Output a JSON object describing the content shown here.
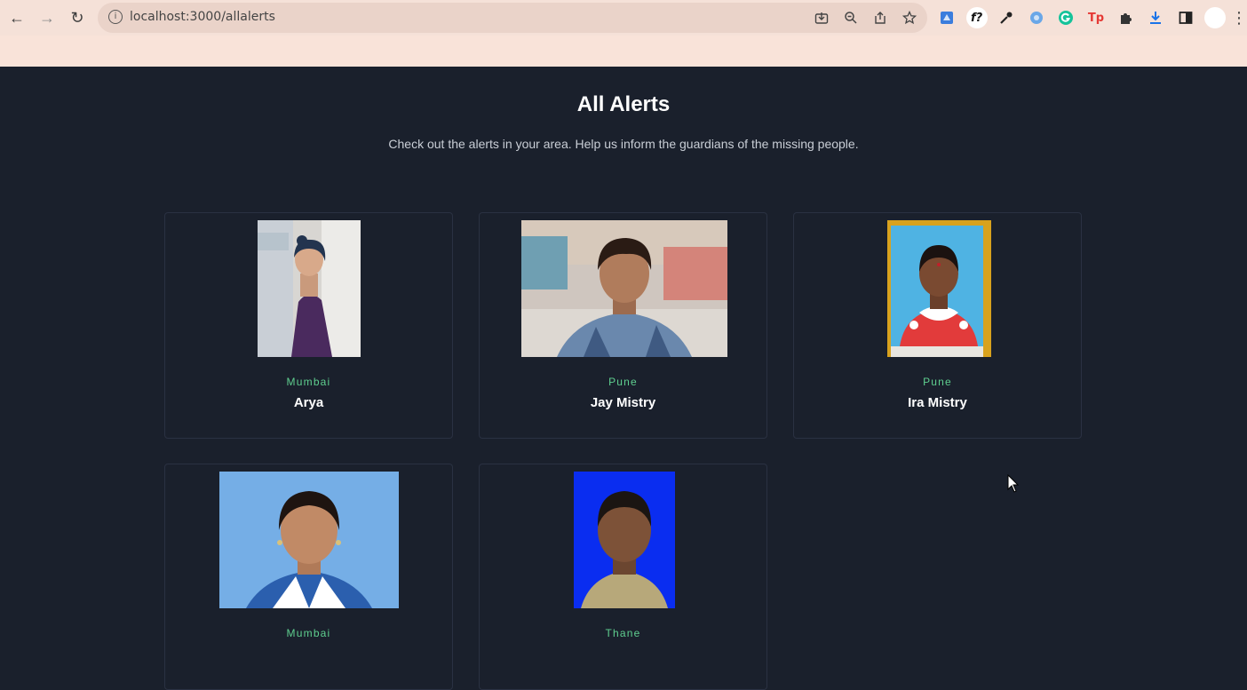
{
  "browser": {
    "url": "localhost:3000/allalerts",
    "back_icon": "←",
    "forward_icon": "→",
    "reload_icon": "↻",
    "info_icon": "i",
    "menu_icon": "⋮",
    "extension_f_label": "f?",
    "extension_tp_label": "Tp"
  },
  "page": {
    "title": "All Alerts",
    "subtitle": "Check out the alerts in your area. Help us inform the guardians of the missing people."
  },
  "alerts": [
    {
      "city": "Mumbai",
      "name": "Arya"
    },
    {
      "city": "Pune",
      "name": "Jay Mistry"
    },
    {
      "city": "Pune",
      "name": "Ira Mistry"
    },
    {
      "city": "Mumbai",
      "name": ""
    },
    {
      "city": "Thane",
      "name": ""
    }
  ],
  "colors": {
    "page_bg": "#1a202c",
    "city_accent": "#5fcf8f",
    "chrome_bg": "#f5e1d8"
  }
}
